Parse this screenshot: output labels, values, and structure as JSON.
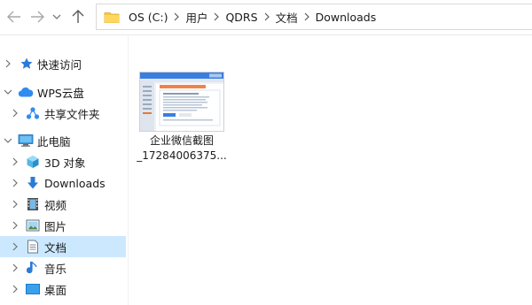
{
  "window": {
    "title": "Downloads"
  },
  "nav": {
    "back_icon": "arrow-left-icon",
    "forward_icon": "arrow-right-icon",
    "recent_icon": "chevron-down-icon",
    "up_icon": "arrow-up-icon"
  },
  "breadcrumb": {
    "icon": "folder-icon",
    "items": [
      "OS (C:)",
      "用户",
      "QDRS",
      "文档",
      "Downloads"
    ]
  },
  "sidebar": {
    "items": [
      {
        "label": "快速访问",
        "icon": "star-icon",
        "expandable": true,
        "expanded": false,
        "selected": false
      },
      {
        "label": "WPS云盘",
        "icon": "cloud-icon",
        "expandable": true,
        "expanded": true,
        "selected": false
      },
      {
        "label": "共享文件夹",
        "icon": "share-icon",
        "expandable": true,
        "expanded": false,
        "selected": false
      },
      {
        "label": "此电脑",
        "icon": "computer-icon",
        "expandable": true,
        "expanded": true,
        "selected": false
      },
      {
        "label": "3D 对象",
        "icon": "cube-icon",
        "expandable": true,
        "expanded": false,
        "selected": false
      },
      {
        "label": "Downloads",
        "icon": "download-icon",
        "expandable": true,
        "expanded": false,
        "selected": false
      },
      {
        "label": "视频",
        "icon": "video-icon",
        "expandable": true,
        "expanded": false,
        "selected": false
      },
      {
        "label": "图片",
        "icon": "picture-icon",
        "expandable": true,
        "expanded": false,
        "selected": false
      },
      {
        "label": "文档",
        "icon": "document-icon",
        "expandable": true,
        "expanded": false,
        "selected": true
      },
      {
        "label": "音乐",
        "icon": "music-icon",
        "expandable": true,
        "expanded": false,
        "selected": false
      },
      {
        "label": "桌面",
        "icon": "desktop-icon",
        "expandable": true,
        "expanded": false,
        "selected": false
      }
    ]
  },
  "files": [
    {
      "name_line1": "企业微信截图",
      "name_line2": "_17284006375...",
      "icon": "image-thumbnail"
    }
  ],
  "colors": {
    "selected_bg": "#cce8ff",
    "accent": "#0078d7",
    "folder_yellow": "#f5c842"
  }
}
